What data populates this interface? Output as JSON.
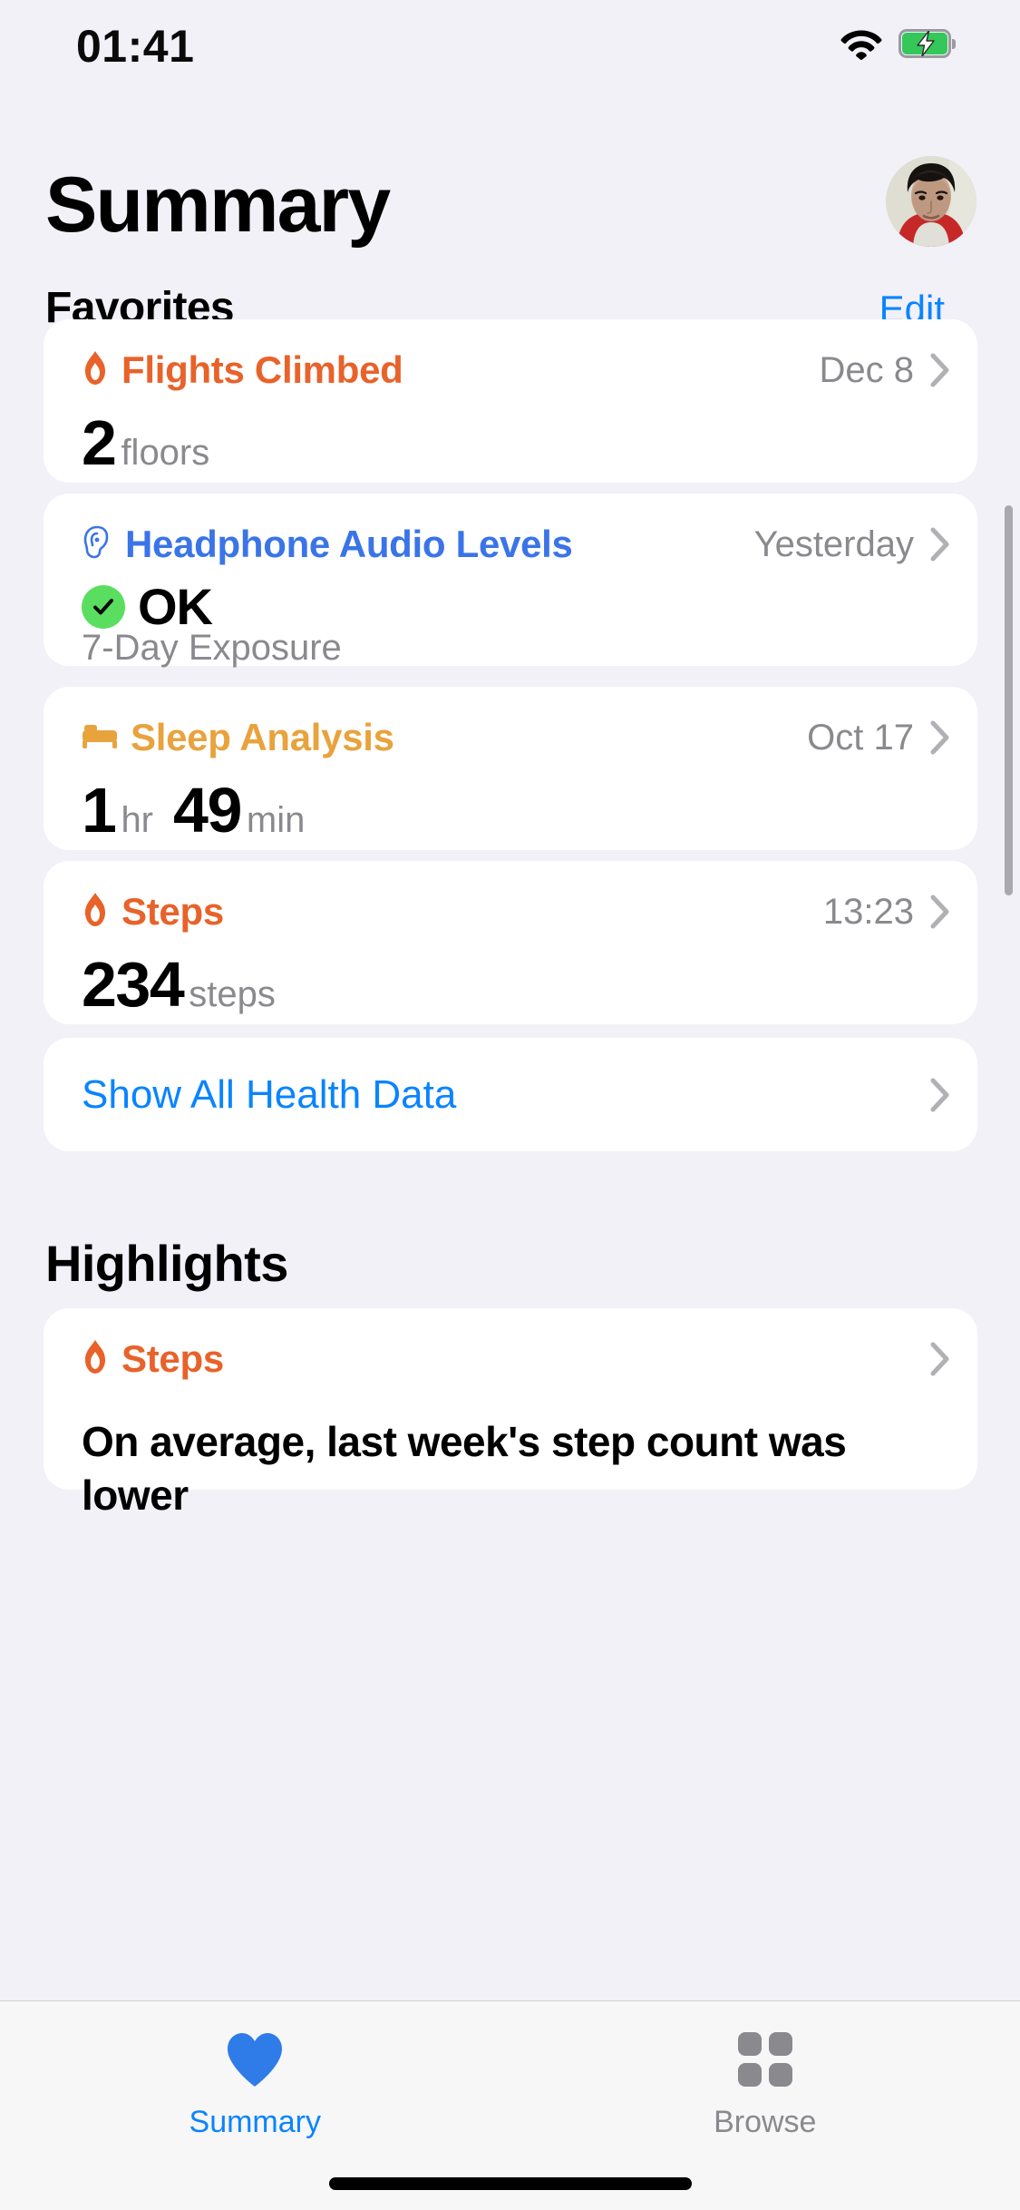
{
  "status_bar": {
    "time": "01:41",
    "wifi_icon": "wifi-icon",
    "battery_icon": "battery-charging-icon",
    "battery_color": "#34C759"
  },
  "header": {
    "title": "Summary",
    "avatar_name": "profile-avatar"
  },
  "favorites": {
    "heading": "Favorites",
    "edit_label": "Edit",
    "cards": [
      {
        "id": "flights-climbed",
        "title": "Flights Climbed",
        "icon": "flame-icon",
        "color": "#E8622A",
        "date": "Dec 8",
        "value": "2",
        "unit": "floors"
      },
      {
        "id": "headphone-audio-levels",
        "title": "Headphone Audio Levels",
        "icon": "ear-icon",
        "color": "#3A74E8",
        "date": "Yesterday",
        "status": "OK",
        "status_icon": "checkmark-circle-icon",
        "status_color": "#5ADE60",
        "subtitle": "7-Day Exposure"
      },
      {
        "id": "sleep-analysis",
        "title": "Sleep Analysis",
        "icon": "bed-icon",
        "color": "#E8A33D",
        "date": "Oct 17",
        "value": "1",
        "unit": "hr",
        "value2": "49",
        "unit2": "min"
      },
      {
        "id": "steps",
        "title": "Steps",
        "icon": "flame-icon",
        "color": "#E8622A",
        "date": "13:23",
        "value": "234",
        "unit": "steps"
      }
    ],
    "show_all_label": "Show All Health Data"
  },
  "highlights": {
    "heading": "Highlights",
    "cards": [
      {
        "id": "steps-highlight",
        "title": "Steps",
        "icon": "flame-icon",
        "color": "#E8622A",
        "body": "On average, last week's step count was lower"
      }
    ]
  },
  "tab_bar": {
    "tabs": [
      {
        "id": "summary",
        "label": "Summary",
        "icon": "heart-icon",
        "active": true
      },
      {
        "id": "browse",
        "label": "Browse",
        "icon": "grid-icon",
        "active": false
      }
    ],
    "active_color": "#0A84FF",
    "inactive_color": "#8A8A8E"
  }
}
